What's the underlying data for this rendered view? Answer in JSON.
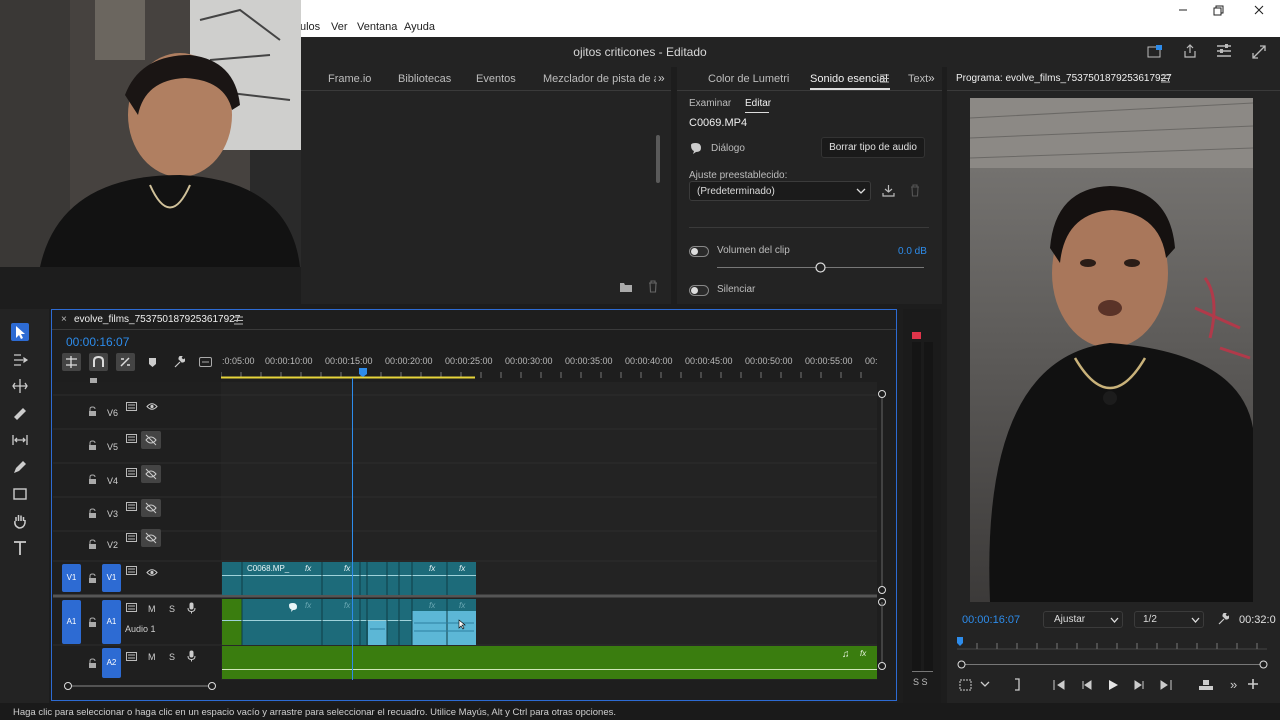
{
  "menu": {
    "items": [
      "ulos",
      "Ver",
      "Ventana",
      "Ayuda"
    ]
  },
  "title": "ojitos criticones - Editado",
  "top_tabs": [
    "Frame.io",
    "Bibliotecas",
    "Eventos",
    "Mezclador de pista de audic"
  ],
  "essential_sound": {
    "tabs": [
      "Color de Lumetri",
      "Sonido esencial",
      "Text"
    ],
    "subtabs": [
      "Examinar",
      "Editar"
    ],
    "clip_name": "C0069.MP4",
    "dialog_label": "Diálogo",
    "clear_button": "Borrar tipo de audio",
    "preset_label": "Ajuste preestablecido:",
    "preset_value": "(Predeterminado)",
    "clip_volume_label": "Volumen del clip",
    "clip_volume_value": "0.0 dB",
    "mute_label": "Silenciar"
  },
  "program": {
    "title": "Programa: evolve_films_7537501879253617927",
    "timecode": "00:00:16:07",
    "fit": "Ajustar",
    "resolution": "1/2",
    "duration": "00:32:0"
  },
  "timeline": {
    "sequence_name": "evolve_films_7537501879253617927",
    "timecode": "00:00:16:07",
    "ruler": [
      ":0:05:00",
      "00:00:10:00",
      "00:00:15:00",
      "00:00:20:00",
      "00:00:25:00",
      "00:00:30:00",
      "00:00:35:00",
      "00:00:40:00",
      "00:00:45:00",
      "00:00:50:00",
      "00:00:55:00",
      "00:"
    ],
    "video_tracks": [
      "V6",
      "V5",
      "V4",
      "V3",
      "V2",
      "V1"
    ],
    "source_v": "V1",
    "source_a": "A1",
    "audio_tracks": [
      "A1",
      "A2"
    ],
    "audio1_name": "Audio 1",
    "clip_label": "C0068.MP_",
    "fx": "fx",
    "mute": "M",
    "solo": "S",
    "meter_s": "S S"
  },
  "status_text": "Haga clic para seleccionar o haga clic en un espacio vacío y arrastre para seleccionar el recuadro. Utilice Mayús, Alt y Ctrl para otras opciones.",
  "colors": {
    "accent": "#2d8ceb",
    "video_clip": "#1d6b7a",
    "audio_clip": "#2f6f4a",
    "audio_green": "#3a7d0f",
    "track_tag": "#2d6bd3"
  }
}
